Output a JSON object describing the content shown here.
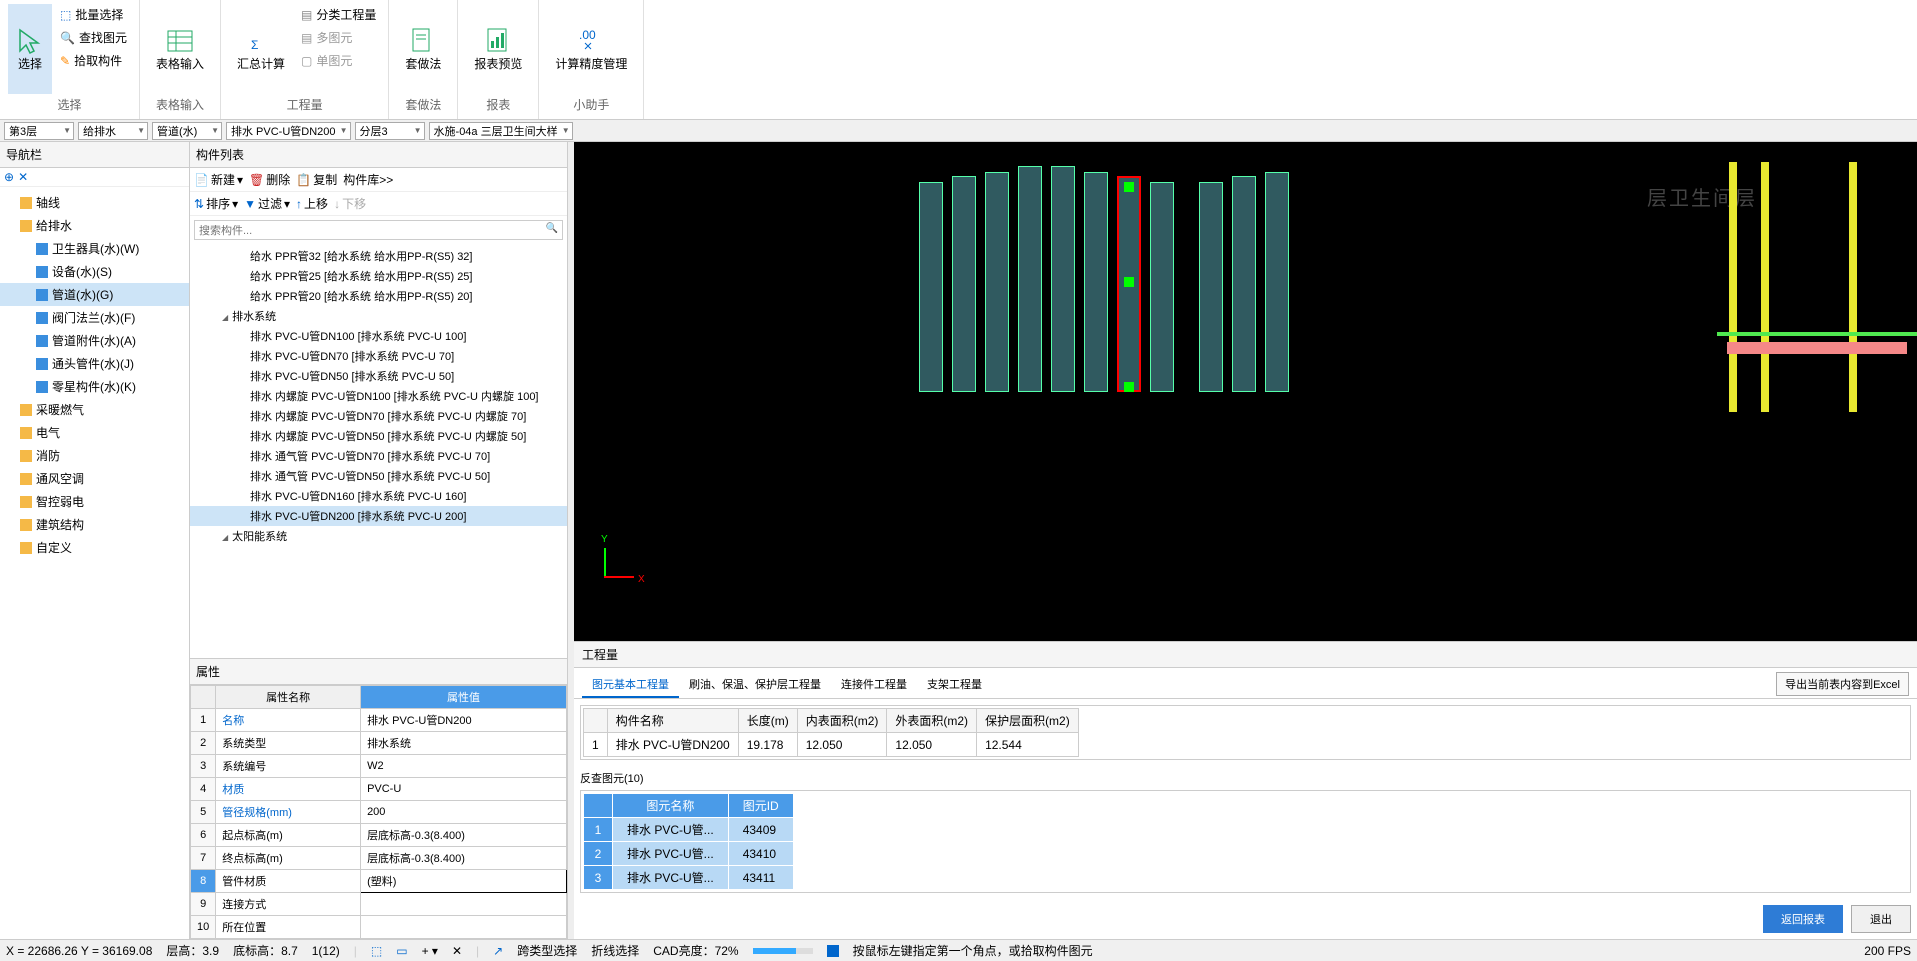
{
  "ribbon": {
    "select": {
      "label": "选择",
      "batch": "批量选择",
      "find": "查找图元",
      "pick": "拾取构件",
      "group": "选择"
    },
    "tableInput": {
      "label": "表格输入",
      "group": "表格输入"
    },
    "calc": {
      "sum": "汇总计算",
      "qty": "分类工程量",
      "multi": "多图元",
      "single": "单图元",
      "group": "工程量"
    },
    "method": {
      "label": "套做法",
      "group": "套做法"
    },
    "report": {
      "label": "报表预览",
      "group": "报表"
    },
    "precision": {
      "label": "计算精度管理",
      "group": "小助手"
    }
  },
  "dropdowns": {
    "floor": "第3层",
    "system": "给排水",
    "category": "管道(水)",
    "spec": "排水 PVC-U管DN200",
    "layer": "分层3",
    "drawing": "水施-04a 三层卫生间大样"
  },
  "navPanel": {
    "title": "导航栏",
    "items": [
      {
        "label": "轴线",
        "type": "folder"
      },
      {
        "label": "给排水",
        "type": "folder",
        "expanded": true
      },
      {
        "label": "卫生器具(水)(W)",
        "type": "sub"
      },
      {
        "label": "设备(水)(S)",
        "type": "sub"
      },
      {
        "label": "管道(水)(G)",
        "type": "sub",
        "selected": true
      },
      {
        "label": "阀门法兰(水)(F)",
        "type": "sub"
      },
      {
        "label": "管道附件(水)(A)",
        "type": "sub"
      },
      {
        "label": "通头管件(水)(J)",
        "type": "sub"
      },
      {
        "label": "零星构件(水)(K)",
        "type": "sub"
      },
      {
        "label": "采暖燃气",
        "type": "folder"
      },
      {
        "label": "电气",
        "type": "folder"
      },
      {
        "label": "消防",
        "type": "folder"
      },
      {
        "label": "通风空调",
        "type": "folder"
      },
      {
        "label": "智控弱电",
        "type": "folder"
      },
      {
        "label": "建筑结构",
        "type": "folder"
      },
      {
        "label": "自定义",
        "type": "folder"
      }
    ]
  },
  "componentPanel": {
    "title": "构件列表",
    "toolbar": {
      "new": "新建",
      "delete": "删除",
      "copy": "复制",
      "lib": "构件库>>",
      "sort": "排序",
      "filter": "过滤",
      "up": "上移",
      "down": "下移"
    },
    "searchPlaceholder": "搜索构件...",
    "items": [
      {
        "label": "给水 PPR管32 [给水系统 给水用PP-R(S5) 32]"
      },
      {
        "label": "给水 PPR管25 [给水系统 给水用PP-R(S5) 25]"
      },
      {
        "label": "给水 PPR管20 [给水系统 给水用PP-R(S5) 20]"
      },
      {
        "label": "排水系统",
        "group": true
      },
      {
        "label": "排水 PVC-U管DN100 [排水系统 PVC-U 100]"
      },
      {
        "label": "排水 PVC-U管DN70 [排水系统 PVC-U 70]"
      },
      {
        "label": "排水 PVC-U管DN50 [排水系统 PVC-U 50]"
      },
      {
        "label": "排水 内螺旋 PVC-U管DN100 [排水系统 PVC-U 内螺旋 100]"
      },
      {
        "label": "排水 内螺旋 PVC-U管DN70 [排水系统 PVC-U 内螺旋 70]"
      },
      {
        "label": "排水 内螺旋 PVC-U管DN50 [排水系统 PVC-U 内螺旋 50]"
      },
      {
        "label": "排水 通气管 PVC-U管DN70 [排水系统 PVC-U 70]"
      },
      {
        "label": "排水 通气管 PVC-U管DN50 [排水系统 PVC-U 50]"
      },
      {
        "label": "排水 PVC-U管DN160 [排水系统 PVC-U 160]"
      },
      {
        "label": "排水 PVC-U管DN200 [排水系统 PVC-U 200]",
        "selected": true
      },
      {
        "label": "太阳能系统",
        "group": true
      }
    ]
  },
  "propsPanel": {
    "title": "属性",
    "headers": {
      "name": "属性名称",
      "value": "属性值"
    },
    "rows": [
      {
        "n": "1",
        "name": "名称",
        "value": "排水 PVC-U管DN200",
        "link": true
      },
      {
        "n": "2",
        "name": "系统类型",
        "value": "排水系统"
      },
      {
        "n": "3",
        "name": "系统编号",
        "value": "W2"
      },
      {
        "n": "4",
        "name": "材质",
        "value": "PVC-U",
        "link": true
      },
      {
        "n": "5",
        "name": "管径规格(mm)",
        "value": "200",
        "link": true
      },
      {
        "n": "6",
        "name": "起点标高(m)",
        "value": "层底标高-0.3(8.400)"
      },
      {
        "n": "7",
        "name": "终点标高(m)",
        "value": "层底标高-0.3(8.400)"
      },
      {
        "n": "8",
        "name": "管件材质",
        "value": "(塑料)",
        "selected": true
      },
      {
        "n": "9",
        "name": "连接方式",
        "value": ""
      },
      {
        "n": "10",
        "name": "所在位置",
        "value": ""
      }
    ]
  },
  "qtyPanel": {
    "title": "工程量",
    "tabs": [
      "图元基本工程量",
      "刷油、保温、保护层工程量",
      "连接件工程量",
      "支架工程量"
    ],
    "export": "导出当前表内容到Excel",
    "headers": [
      "",
      "构件名称",
      "长度(m)",
      "内表面积(m2)",
      "外表面积(m2)",
      "保护层面积(m2)"
    ],
    "row": {
      "n": "1",
      "name": "排水 PVC-U管DN200",
      "len": "19.178",
      "inner": "12.050",
      "outer": "12.050",
      "protect": "12.544"
    },
    "elemTitle": "反查图元(10)",
    "elemHeaders": [
      "图元名称",
      "图元ID"
    ],
    "elemRows": [
      {
        "n": "1",
        "name": "排水 PVC-U管...",
        "id": "43409"
      },
      {
        "n": "2",
        "name": "排水 PVC-U管...",
        "id": "43410"
      },
      {
        "n": "3",
        "name": "排水 PVC-U管...",
        "id": "43411"
      }
    ],
    "returnBtn": "返回报表",
    "exitBtn": "退出"
  },
  "statusBar": {
    "coords": "X = 22686.26 Y = 36169.08",
    "floorH": "层高：3.9",
    "baseH": "底标高：8.7",
    "count": "1(12)",
    "crossType": "跨类型选择",
    "foldSel": "折线选择",
    "cadW": "CAD亮度：72%",
    "hint": "按鼠标左键指定第一个角点，或拾取构件图元",
    "fps": "200 FPS"
  },
  "viewport": {
    "axisX": "X",
    "axisY": "Y",
    "watermark": "层卫生间层"
  }
}
